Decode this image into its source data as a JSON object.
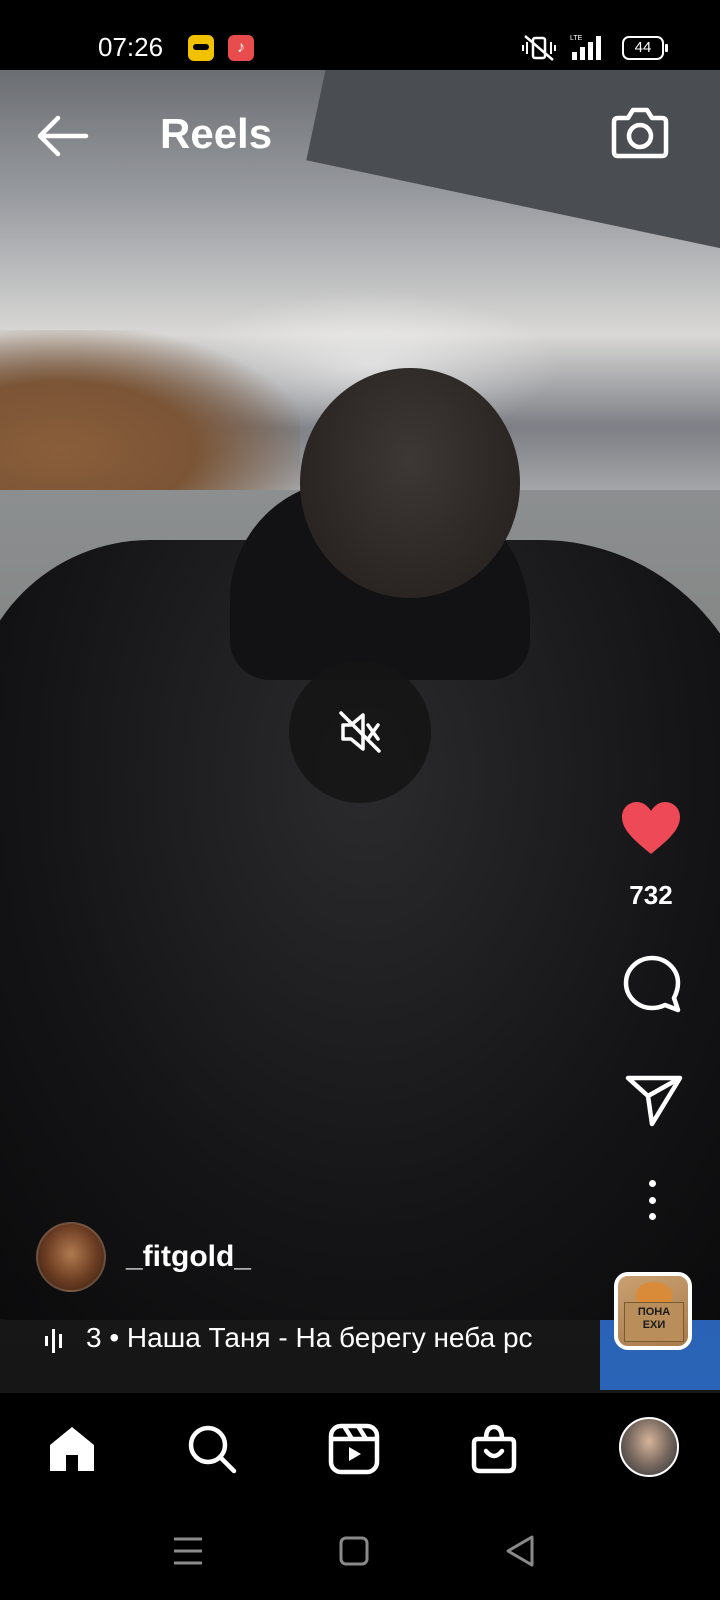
{
  "status_bar": {
    "time": "07:26",
    "app_icons": [
      "snapchat-icon",
      "music-icon"
    ],
    "mute_icon": "vibrate-off-icon",
    "network": "LTE",
    "battery": "44"
  },
  "header": {
    "back_icon": "arrow-left-icon",
    "title": "Reels",
    "camera_icon": "camera-icon"
  },
  "video": {
    "mute_state_icon": "speaker-muted-icon"
  },
  "actions": {
    "like_icon": "heart-filled-icon",
    "like_color": "#ed4956",
    "like_count": "732",
    "comment_icon": "comment-icon",
    "share_icon": "send-icon",
    "more_icon": "more-vertical-icon"
  },
  "author": {
    "username": "_fitgold_"
  },
  "audio": {
    "icon": "audio-waveform-icon",
    "text": "3 • Наша Таня - На берегу неба   рс",
    "thumb_text": "ПОНА ЕХИ"
  },
  "bottom_nav": {
    "items": [
      "home-icon",
      "search-icon",
      "reels-icon",
      "shop-icon",
      "profile-avatar"
    ]
  },
  "system_nav": {
    "items": [
      "menu-icon",
      "home-square-icon",
      "back-triangle-icon"
    ]
  }
}
